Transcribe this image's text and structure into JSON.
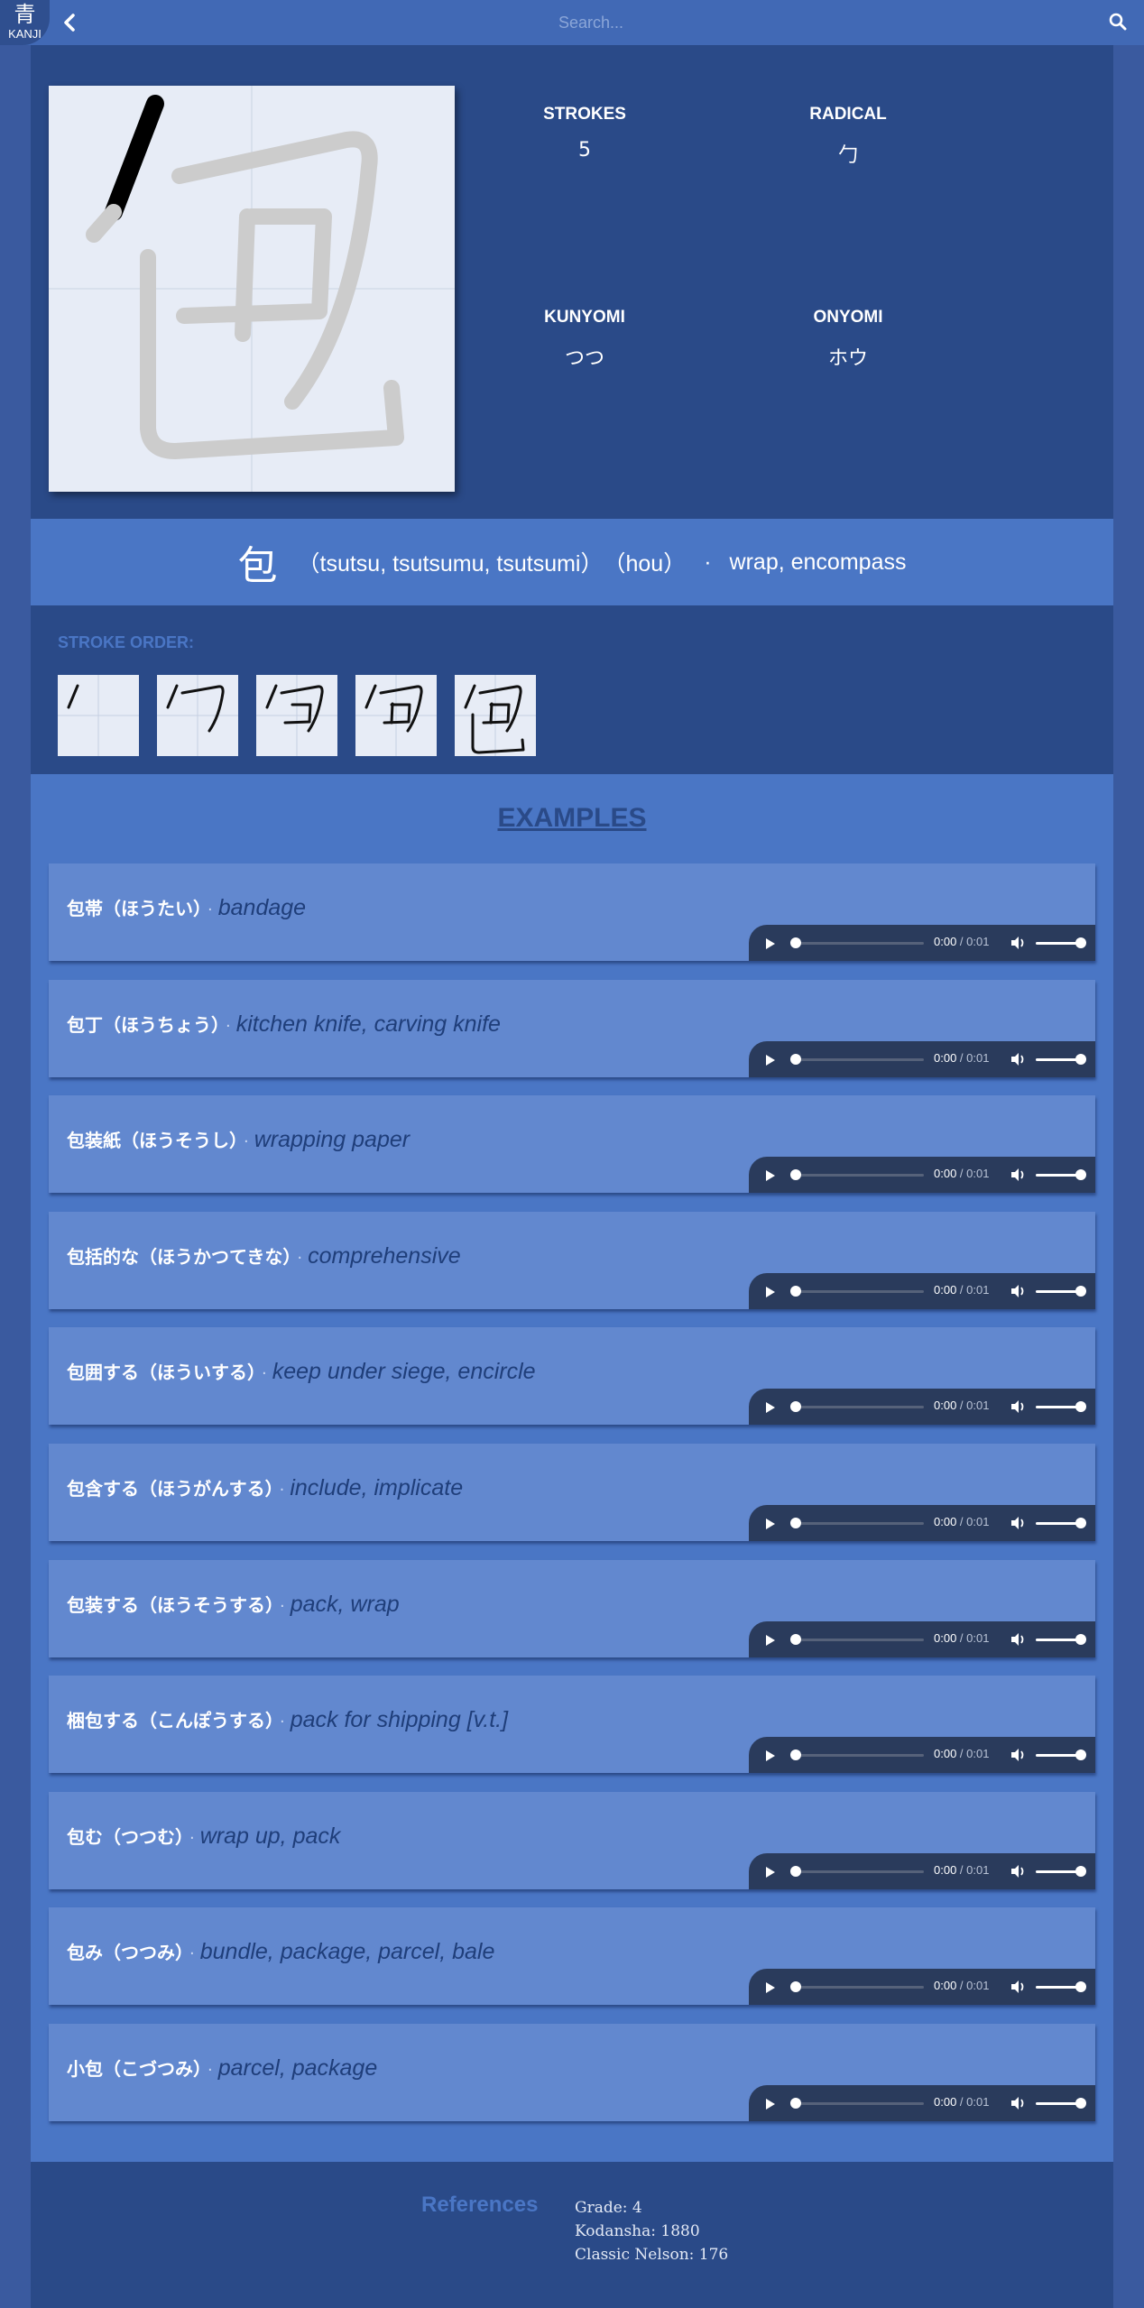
{
  "header": {
    "logo_kanji": "青",
    "logo_text": "KANJI",
    "back_icon": "chevron-left-icon",
    "search_placeholder": "Search...",
    "search_icon": "search-icon"
  },
  "kanji": {
    "character": "包",
    "strokes_label": "STROKES",
    "strokes_value": "5",
    "radical_label": "RADICAL",
    "radical_value": "勹",
    "kunyomi_label": "KUNYOMI",
    "kunyomi_value": "つつ",
    "onyomi_label": "ONYOMI",
    "onyomi_value": "ホウ"
  },
  "summary": {
    "character": "包",
    "kun": "（tsutsu, tsutsumu, tsutsumi）",
    "on": "（hou）",
    "separator": "·",
    "meaning": "wrap, encompass"
  },
  "stroke_order": {
    "label": "STROKE ORDER:",
    "steps": 5
  },
  "examples": {
    "title": "EXAMPLES",
    "separator": "·",
    "time_current": "0:00",
    "time_divider": " / ",
    "time_total": "0:01",
    "items": [
      {
        "word": "包帯（ほうたい）",
        "meaning": "bandage"
      },
      {
        "word": "包丁（ほうちょう）",
        "meaning": "kitchen knife, carving knife"
      },
      {
        "word": "包装紙（ほうそうし）",
        "meaning": "wrapping paper"
      },
      {
        "word": "包括的な（ほうかつてきな）",
        "meaning": "comprehensive"
      },
      {
        "word": "包囲する（ほういする）",
        "meaning": "keep under siege, encircle"
      },
      {
        "word": "包含する（ほうがんする）",
        "meaning": "include, implicate"
      },
      {
        "word": "包装する（ほうそうする）",
        "meaning": "pack, wrap"
      },
      {
        "word": "梱包する（こんぽうする）",
        "meaning": "pack for shipping [v.t.]"
      },
      {
        "word": "包む（つつむ）",
        "meaning": "wrap up, pack"
      },
      {
        "word": "包み（つつみ）",
        "meaning": "bundle, package, parcel, bale"
      },
      {
        "word": "小包（こづつみ）",
        "meaning": "parcel, package"
      }
    ]
  },
  "references": {
    "title": "References",
    "grade": "Grade: 4",
    "kodansha": "Kodansha: 1880",
    "nelson": "Classic Nelson: 176"
  },
  "colors": {
    "page_bg": "#3a5a9f",
    "header_bg": "#4169b5",
    "panel_bg": "#2a4a88",
    "accent": "#4a76c5",
    "card_bg": "#6288cf",
    "player_bg": "#2a3b5c"
  }
}
